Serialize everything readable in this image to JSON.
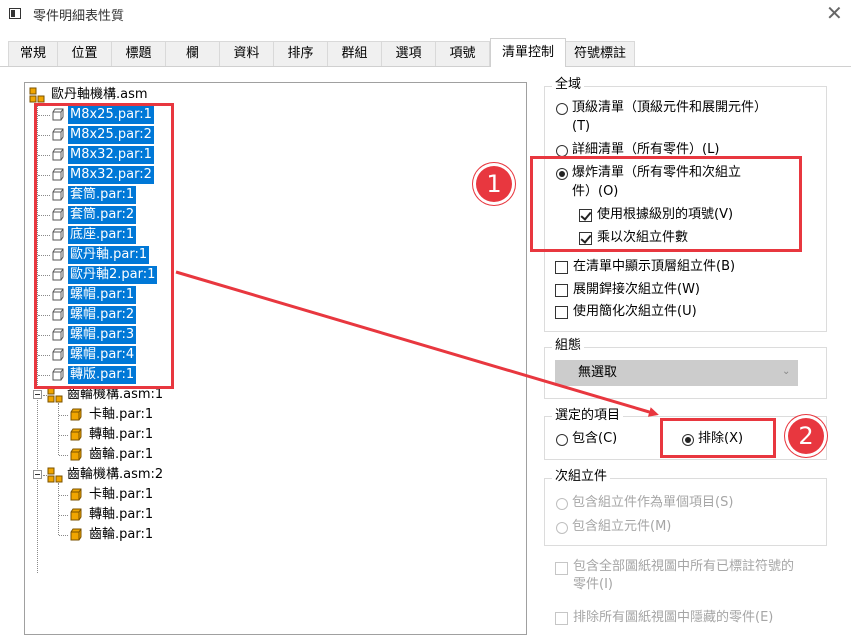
{
  "window": {
    "title": "零件明細表性質",
    "close_glyph": "✕"
  },
  "tabs": [
    {
      "label": "常規"
    },
    {
      "label": "位置"
    },
    {
      "label": "標題"
    },
    {
      "label": "欄"
    },
    {
      "label": "資料"
    },
    {
      "label": "排序"
    },
    {
      "label": "群組"
    },
    {
      "label": "選項"
    },
    {
      "label": "項號"
    },
    {
      "label": "清單控制",
      "active": true
    },
    {
      "label": "符號標註"
    }
  ],
  "tree": {
    "root": "歐丹軸機構.asm",
    "selected_items": [
      "M8x25.par:1",
      "M8x25.par:2",
      "M8x32.par:1",
      "M8x32.par:2",
      "套筒.par:1",
      "套筒.par:2",
      "底座.par:1",
      "歐丹軸.par:1",
      "歐丹軸2.par:1",
      "螺帽.par:1",
      "螺帽.par:2",
      "螺帽.par:3",
      "螺帽.par:4",
      "轉版.par:1"
    ],
    "subassemblies": [
      {
        "label": "齒輪機構.asm:1",
        "children": [
          "卡軸.par:1",
          "轉軸.par:1",
          "齒輪.par:1"
        ]
      },
      {
        "label": "齒輪機構.asm:2",
        "children": [
          "卡軸.par:1",
          "轉軸.par:1",
          "齒輪.par:1"
        ]
      }
    ]
  },
  "scope": {
    "title": "全域",
    "top_level": {
      "line1": "頂級清單（頂級元件和展開元件）",
      "line2": "(T)"
    },
    "detailed": "詳細清單（所有零件）(L)",
    "exploded": {
      "line1": "爆炸清單（所有零件和次組立",
      "line2": "件）(O)"
    },
    "use_level_numbers": "使用根據級別的項號(V)",
    "multiply_qty": "乘以次組立件數",
    "show_top_asm": "在清單中顯示頂層組立件(B)",
    "expand_weldments": "展開銲接次組立件(W)",
    "use_simplified": "使用簡化次組立件(U)"
  },
  "state": {
    "title": "組態",
    "value": "無選取"
  },
  "selected_items_group": {
    "title": "選定的項目",
    "include": "包含(C)",
    "exclude": "排除(X)"
  },
  "subassembly": {
    "title": "次組立件",
    "as_single": "包含組立件作為單個項目(S)",
    "components": "包含組立元件(M)"
  },
  "drawing_view": {
    "include_all_line1": "包含全部圖紙視圖中所有已標註符號的",
    "include_all_line2": "零件(I)",
    "exclude_hidden": "排除所有圖紙視圖中隱藏的零件(E)"
  },
  "annotations": {
    "badge1": "1",
    "badge2": "2",
    "color": "#e8373f"
  },
  "colors": {
    "selection": "#0078d7",
    "part_icon": "#f0a500",
    "asm_icon": "#e8a000"
  }
}
